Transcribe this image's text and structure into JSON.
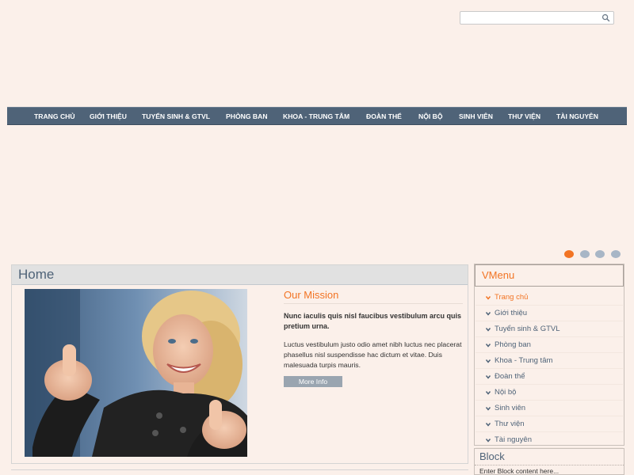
{
  "search": {
    "placeholder": ""
  },
  "nav": {
    "items": [
      "TRANG CHỦ",
      "GIỚI THIỆU",
      "TUYỂN SINH & GTVL",
      "PHÒNG BAN",
      "KHOA - TRUNG TÂM",
      "ĐOÀN THỂ",
      "NỘI BỘ",
      "SINH VIÊN",
      "THƯ VIỆN",
      "TÀI NGUYÊN"
    ]
  },
  "slider": {
    "dots": 4,
    "active": 1
  },
  "main": {
    "title": "Home",
    "mission": {
      "heading": "Our Mission",
      "lead": "Nunc iaculis quis nisl faucibus vestibulum arcu quis pretium urna.",
      "body": "Luctus vestibulum justo odio amet nibh luctus nec placerat phasellus nisl suspendisse hac dictum et vitae. Duis malesuada turpis mauris.",
      "button": "More Info"
    }
  },
  "vmenu": {
    "title": "VMenu",
    "items": [
      "Trang chủ",
      "Giới thiệu",
      "Tuyển sinh & GTVL",
      "Phòng ban",
      "Khoa - Trung tâm",
      "Đoàn thể",
      "Nội bộ",
      "Sinh viên",
      "Thư viện",
      "Tài nguyên"
    ],
    "active_index": 0
  },
  "block": {
    "title": "Block",
    "content": "Enter Block content here..."
  },
  "colors": {
    "background": "#fbf0ea",
    "nav": "#4f6378",
    "accent": "#f27424"
  }
}
